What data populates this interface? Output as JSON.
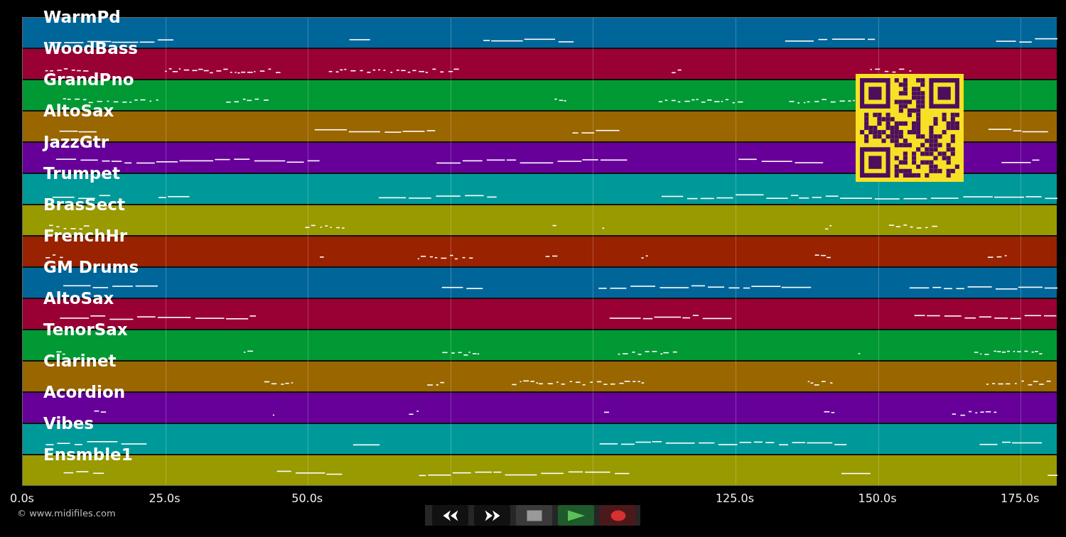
{
  "tracks": [
    {
      "name": "WarmPd",
      "color": "#006699"
    },
    {
      "name": "WoodBass",
      "color": "#990033"
    },
    {
      "name": "GrandPno",
      "color": "#009933"
    },
    {
      "name": "AltoSax",
      "color": "#996600"
    },
    {
      "name": "JazzGtr",
      "color": "#660099"
    },
    {
      "name": "Trumpet",
      "color": "#009999"
    },
    {
      "name": "BrasSect",
      "color": "#999900"
    },
    {
      "name": "FrenchHr",
      "color": "#992200"
    },
    {
      "name": "GM Drums",
      "color": "#006699"
    },
    {
      "name": "AltoSax",
      "color": "#990033"
    },
    {
      "name": "TenorSax",
      "color": "#009933"
    },
    {
      "name": "Clarinet",
      "color": "#996600"
    },
    {
      "name": "Acordion",
      "color": "#660099"
    },
    {
      "name": "Vibes",
      "color": "#009999"
    },
    {
      "name": "Ensmble1",
      "color": "#999900"
    }
  ],
  "time_axis": [
    "0.0s",
    "25.0s",
    "50.0s",
    "125.0s",
    "150.0s",
    "175.0s"
  ],
  "credit": "© www.midifiles.com",
  "transport": [
    {
      "kind": "rewind"
    },
    {
      "kind": "forward"
    },
    {
      "kind": "stop"
    },
    {
      "kind": "play"
    },
    {
      "kind": "record"
    }
  ]
}
